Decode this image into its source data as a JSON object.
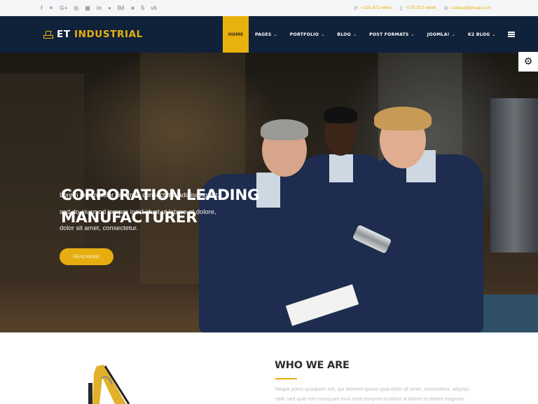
{
  "topbar": {
    "social_icons": [
      {
        "name": "facebook-icon",
        "glyph": "f"
      },
      {
        "name": "twitter-icon",
        "glyph": "🐦"
      },
      {
        "name": "google-plus-icon",
        "glyph": "G+"
      },
      {
        "name": "pinterest-icon",
        "glyph": "℗"
      },
      {
        "name": "youtube-icon",
        "glyph": "▣"
      },
      {
        "name": "linkedin-icon",
        "glyph": "in"
      },
      {
        "name": "dribbble-icon",
        "glyph": "◍"
      },
      {
        "name": "behance-icon",
        "glyph": "Bē"
      },
      {
        "name": "flickr-icon",
        "glyph": "▦"
      },
      {
        "name": "skype-icon",
        "glyph": "S"
      },
      {
        "name": "vk-icon",
        "glyph": "vk"
      }
    ],
    "contacts": [
      {
        "icon": "phone-icon",
        "glyph": "✆",
        "text": "+228 872 4444"
      },
      {
        "icon": "mobile-icon",
        "glyph": "▯",
        "text": "+775 872 4444"
      },
      {
        "icon": "envelope-icon",
        "glyph": "✉",
        "text": "contact@email.com"
      }
    ]
  },
  "header": {
    "logo_part1": "ET",
    "logo_part2": "INDUSTRIAL",
    "nav": [
      {
        "label": "HOME",
        "active": true,
        "dropdown": false
      },
      {
        "label": "PAGES",
        "active": false,
        "dropdown": true
      },
      {
        "label": "PORTFOLIO",
        "active": false,
        "dropdown": true
      },
      {
        "label": "BLOG",
        "active": false,
        "dropdown": true
      },
      {
        "label": "POST FORMATS",
        "active": false,
        "dropdown": true
      },
      {
        "label": "JOOMLA!",
        "active": false,
        "dropdown": true
      },
      {
        "label": "K2 BLOG",
        "active": false,
        "dropdown": true
      }
    ],
    "chevron_glyph": "⌄",
    "menu_icon": "hamburger-icon"
  },
  "hero": {
    "title_line1": "CORPORATION LEADING",
    "title_line2": "MANUFACTURER",
    "description_lines": [
      "Lorem ipsum dolor sit amet, consectetur adipiscing elit,",
      "sed do eiusmod tempor incid idunt ut labore et dolore,",
      "dolor sit amet, consectetur."
    ],
    "cta_label": "READ MORE"
  },
  "settings": {
    "icon": "gear-icon",
    "glyph": "⚙"
  },
  "about": {
    "title": "WHO WE ARE",
    "description_lines": [
      "Neque porro quisquam est, qui dolorem ipsum quia dolor sit amet, consectetur, adipisci",
      "velit, sed quia non numquam eius modi tempora incidunt ut labore et dolore magnam"
    ]
  },
  "colors": {
    "accent": "#e8b10e",
    "header_bg": "#10213a",
    "topbar_bg": "#f5f6f7"
  }
}
